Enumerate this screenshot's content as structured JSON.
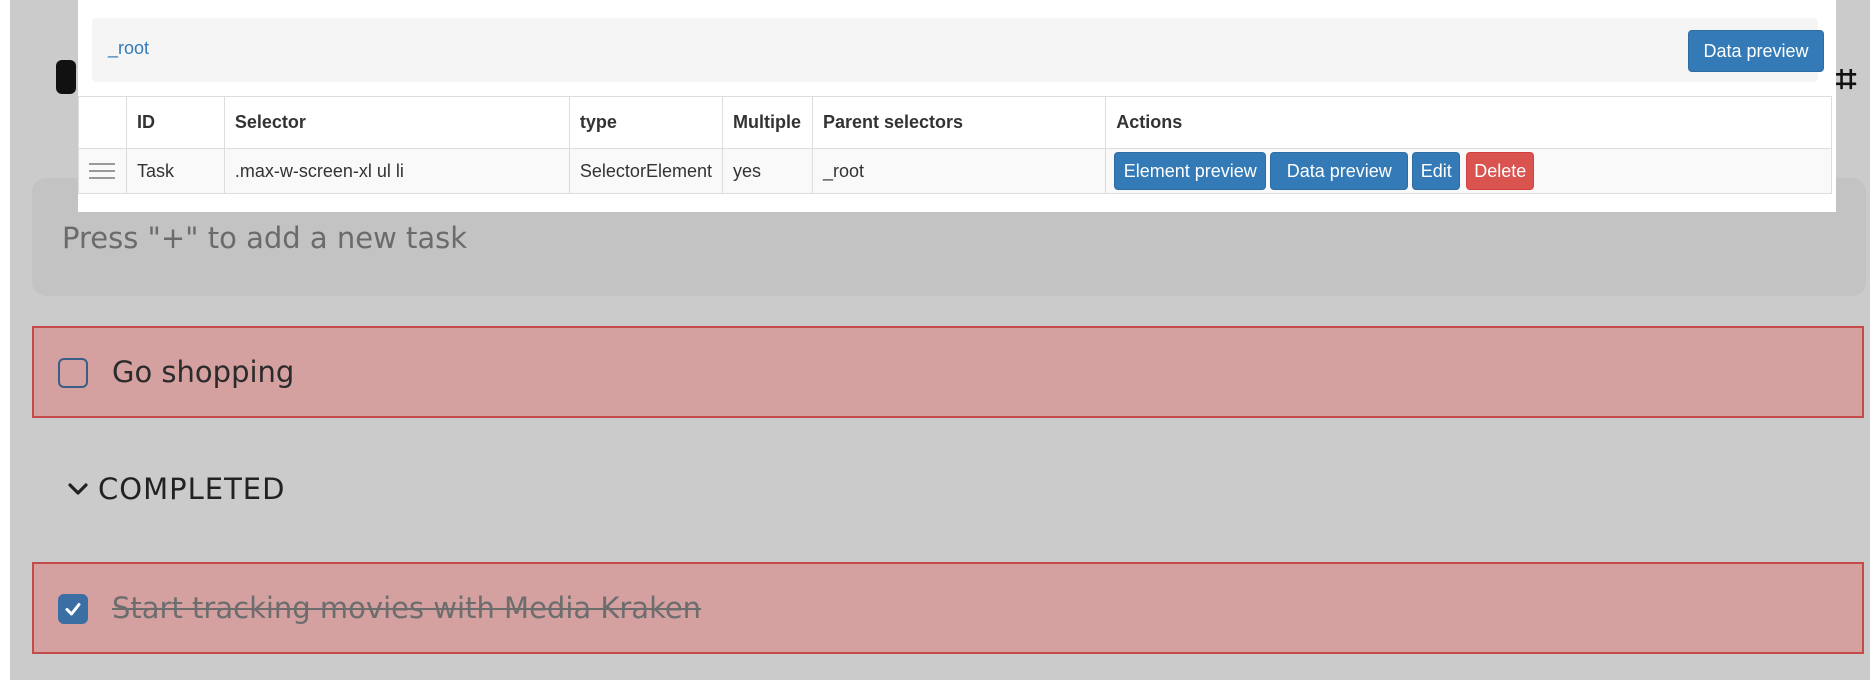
{
  "app": {
    "new_task_placeholder": "Press \"+\" to add a new task",
    "active_tasks": [
      {
        "label": "Go shopping",
        "done": false
      }
    ],
    "completed_label": "COMPLETED",
    "completed_tasks": [
      {
        "label": "Start tracking movies with Media Kraken",
        "done": true
      }
    ],
    "colors": {
      "overlay_background": "#cbcbcb",
      "highlight_fill": "#d4a0a0",
      "highlight_border": "#c54b4b",
      "checkbox_checked": "#3b6ea3"
    }
  },
  "scraper": {
    "breadcrumb": {
      "root": "_root",
      "data_preview_label": "Data preview"
    },
    "table": {
      "headers": [
        "ID",
        "Selector",
        "type",
        "Multiple",
        "Parent selectors",
        "Actions"
      ],
      "rows": [
        {
          "id": "Task",
          "selector": ".max-w-screen-xl ul li",
          "type": "SelectorElement",
          "multiple": "yes",
          "parent_selectors": "_root",
          "actions": {
            "element_preview": "Element preview",
            "data_preview": "Data preview",
            "edit": "Edit",
            "delete": "Delete"
          }
        }
      ]
    },
    "colors": {
      "primary": "#337ab7",
      "danger": "#d9534f",
      "link": "#337ab7"
    }
  }
}
